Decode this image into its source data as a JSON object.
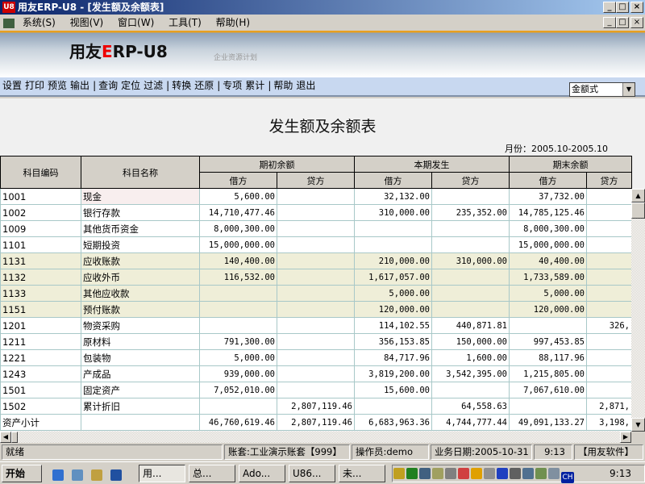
{
  "window": {
    "title": "用友ERP-U8 - [发生额及余额表]"
  },
  "menu": [
    "系统(S)",
    "视图(V)",
    "窗口(W)",
    "工具(T)",
    "帮助(H)"
  ],
  "banner": {
    "brand_a": "用友",
    "brand_b": "E",
    "brand_c": "RP-U8",
    "subtitle": "企业资源计划"
  },
  "toolbar": [
    [
      "设置",
      "打印",
      "预览",
      "输出"
    ],
    [
      "查询",
      "定位",
      "过滤"
    ],
    [
      "转换",
      "还原"
    ],
    [
      "专项",
      "累计"
    ],
    [
      "帮助",
      "退出"
    ]
  ],
  "format_select": "金额式",
  "report": {
    "title": "发生额及余额表",
    "month": "月份：2005.10-2005.10",
    "headers": {
      "code": "科目编码",
      "name": "科目名称",
      "open": "期初余额",
      "period": "本期发生",
      "close": "期末余额",
      "debit": "借方",
      "credit": "贷方"
    },
    "rows": [
      [
        "1001",
        "现金",
        "5,600.00",
        "",
        "32,132.00",
        "",
        "37,732.00",
        ""
      ],
      [
        "1002",
        "银行存款",
        "14,710,477.46",
        "",
        "310,000.00",
        "235,352.00",
        "14,785,125.46",
        ""
      ],
      [
        "1009",
        "其他货币资金",
        "8,000,300.00",
        "",
        "",
        "",
        "8,000,300.00",
        ""
      ],
      [
        "1101",
        "短期投资",
        "15,000,000.00",
        "",
        "",
        "",
        "15,000,000.00",
        ""
      ],
      [
        "1131",
        "应收账款",
        "140,400.00",
        "",
        "210,000.00",
        "310,000.00",
        "40,400.00",
        ""
      ],
      [
        "1132",
        "应收外币",
        "116,532.00",
        "",
        "1,617,057.00",
        "",
        "1,733,589.00",
        ""
      ],
      [
        "1133",
        "其他应收款",
        "",
        "",
        "5,000.00",
        "",
        "5,000.00",
        ""
      ],
      [
        "1151",
        "预付账款",
        "",
        "",
        "120,000.00",
        "",
        "120,000.00",
        ""
      ],
      [
        "1201",
        "物资采购",
        "",
        "",
        "114,102.55",
        "440,871.81",
        "",
        "326,"
      ],
      [
        "1211",
        "原材料",
        "791,300.00",
        "",
        "356,153.85",
        "150,000.00",
        "997,453.85",
        ""
      ],
      [
        "1221",
        "包装物",
        "5,000.00",
        "",
        "84,717.96",
        "1,600.00",
        "88,117.96",
        ""
      ],
      [
        "1243",
        "产成品",
        "939,000.00",
        "",
        "3,819,200.00",
        "3,542,395.00",
        "1,215,805.00",
        ""
      ],
      [
        "1501",
        "固定资产",
        "7,052,010.00",
        "",
        "15,600.00",
        "",
        "7,067,610.00",
        ""
      ],
      [
        "1502",
        "累计折旧",
        "",
        "2,807,119.46",
        "",
        "64,558.63",
        "",
        "2,871,"
      ],
      [
        "资产小计",
        "",
        "46,760,619.46",
        "2,807,119.46",
        "6,683,963.36",
        "4,744,777.44",
        "49,091,133.27",
        "3,198,"
      ]
    ]
  },
  "status": {
    "ready": "就绪",
    "account": "账套:工业演示账套【999】",
    "operator": "操作员:demo",
    "date": "业务日期:2005-10-31",
    "time": "9:13",
    "vendor": "【用友软件】"
  },
  "taskbar": {
    "start": "开始",
    "tasks": [
      "用...",
      "总...",
      "Ado...",
      "U86...",
      "未..."
    ],
    "lang": "CH",
    "clock": "9:13"
  }
}
